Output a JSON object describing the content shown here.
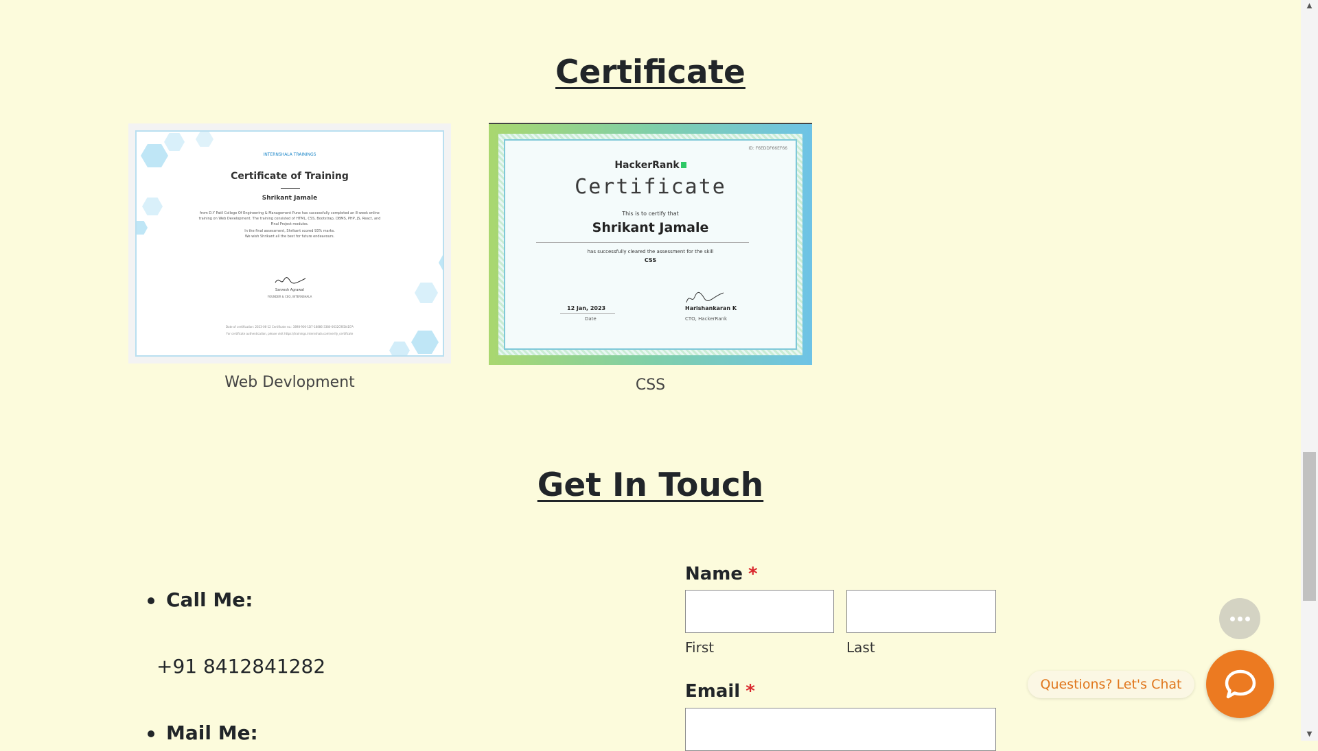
{
  "certificates_section": {
    "title": "Certificate",
    "items": [
      {
        "caption": "Web Devlopment",
        "image": {
          "brand": "INTERNSHALA TRAININGS",
          "heading": "Certificate of Training",
          "name": "Shrikant Jamale",
          "body1": "from D.Y Patil College Of Engineering & Management Pune has successfully completed an 8-week online",
          "body2": "training on Web Development. The training consisted of HTML, CSS, Bootstrap, DBMS, PHP, JS, React, and",
          "body3": "Final Project modules.",
          "body4": "In the final assessment, Shrikant scored 93% marks.",
          "body5": "We wish Shrikant all the best for future endeavours.",
          "signer": "Sarvesh Agrawal",
          "signer_title": "FOUNDER & CEO, INTERNSHALA",
          "footer1": "Date of certification: 2023-06-12        Certificate no.: 3898-900-1D7-18886-3380-0632C9ED4D7A",
          "footer2": "For certificate authentication, please visit https://trainings.internshala.com/verify_certificate"
        }
      },
      {
        "caption": "CSS",
        "image": {
          "id": "ID: F6EDDF66EF66",
          "brand": "HackerRank",
          "heading": "Certificate",
          "certify": "This is to certify that",
          "name": "Shrikant Jamale",
          "cleared": "has successfully cleared the assessment for the skill",
          "skill": "CSS",
          "date": "12 Jan, 2023",
          "date_label": "Date",
          "signer": "Harishankaran K",
          "signer_title": "CTO, HackerRank"
        }
      }
    ]
  },
  "contact_section": {
    "title": "Get In Touch",
    "list": {
      "call_label": "Call Me:",
      "phone": "+91 8412841282",
      "mail_label": "Mail Me:"
    },
    "form": {
      "name_label": "Name",
      "required_marker": "*",
      "first_label": "First",
      "last_label": "Last",
      "email_label": "Email"
    }
  },
  "chat_widget": {
    "prompt": "Questions? Let's Chat"
  },
  "colors": {
    "page_background": "#fcfbdc",
    "chat_accent": "#ec7a21",
    "required": "#d9262c"
  },
  "icons": [
    "more-dots-icon",
    "chat-bubble-icon",
    "scroll-up-icon",
    "scroll-down-icon"
  ]
}
